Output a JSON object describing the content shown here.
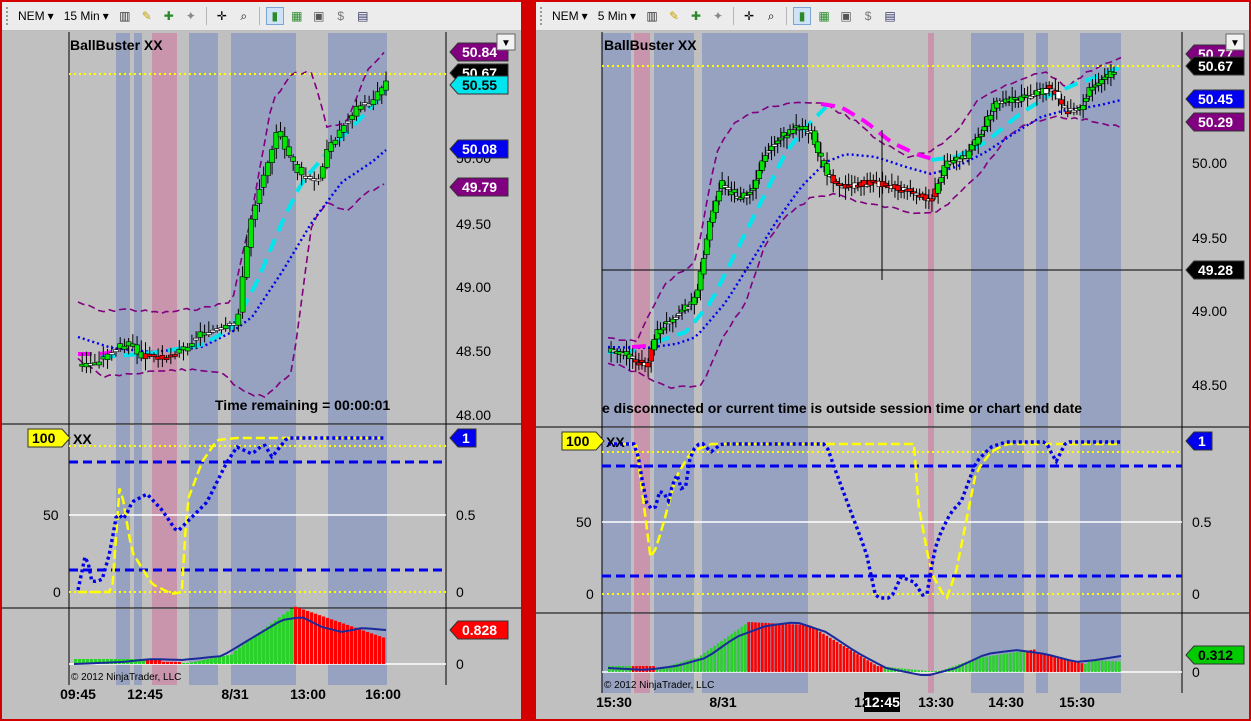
{
  "colors": {
    "frame": "#d40000",
    "panel": "#c0c0c0",
    "session_band": "#8e9cc0",
    "highlight_band": "#c98da8",
    "up": "#00e600",
    "down": "#ff0000",
    "doji": "#ffffff",
    "cyan_ma": "#00e5ee",
    "magenta_ma": "#ff00ff",
    "blue_dots": "#0000ee",
    "band": "#800080",
    "yellow": "#ffff00"
  },
  "charts": [
    {
      "id": "left",
      "toolbar": {
        "instrument": "NEM",
        "interval": "15 Min"
      },
      "title": "BallBuster XX",
      "status_text": "Time remaining = 00:00:01",
      "price_axis": [
        "50.00",
        "49.50",
        "49.00",
        "48.50",
        "48.00"
      ],
      "price_tags": [
        {
          "value": "50.84",
          "color": "#800080",
          "text": "#ffffff"
        },
        {
          "value": "50.67",
          "color": "#000000",
          "text": "#ffffff"
        },
        {
          "value": "50.55",
          "color": "#00e5ee",
          "text": "#000000"
        },
        {
          "value": "50.08",
          "color": "#0000ee",
          "text": "#ffffff"
        },
        {
          "value": "49.79",
          "color": "#800080",
          "text": "#ffffff"
        }
      ],
      "osc": {
        "title": "XX",
        "left_tag": "100",
        "right_tag": "1",
        "left_axis": [
          "50",
          "0"
        ],
        "right_axis": [
          "0.5",
          "0"
        ]
      },
      "hist": {
        "tag": "0.828",
        "tag_color": "#ff0000",
        "axis": [
          "0"
        ],
        "copyright": "© 2012 NinjaTrader, LLC"
      },
      "time_axis": [
        "09:45",
        "12:45",
        "8/31",
        "13:00",
        "16:00"
      ]
    },
    {
      "id": "right",
      "toolbar": {
        "instrument": "NEM",
        "interval": "5 Min"
      },
      "title": "BallBuster XX",
      "status_text": "e disconnected or current time is outside session time or chart end date",
      "price_axis": [
        "50.00",
        "49.50",
        "49.00",
        "48.50"
      ],
      "price_tags": [
        {
          "value": "50.77",
          "color": "#800080",
          "text": "#ffffff"
        },
        {
          "value": "50.67",
          "color": "#000000",
          "text": "#ffffff"
        },
        {
          "value": "50.45",
          "color": "#0000ee",
          "text": "#ffffff"
        },
        {
          "value": "50.29",
          "color": "#800080",
          "text": "#ffffff"
        },
        {
          "value": "49.28",
          "color": "#000000",
          "text": "#ffffff"
        }
      ],
      "osc": {
        "title": "XX",
        "left_tag": "100",
        "right_tag": "1",
        "left_axis": [
          "50",
          "0"
        ],
        "right_axis": [
          "0.5",
          "0"
        ]
      },
      "hist": {
        "tag": "0.312",
        "tag_color": "#00cc00",
        "axis": [
          "0"
        ],
        "copyright": "© 2012 NinjaTrader, LLC"
      },
      "time_axis": [
        "15:30",
        "8/31",
        "12:45",
        "13:30",
        "14:30",
        "15:30"
      ],
      "cursor_time": "12:45"
    }
  ]
}
